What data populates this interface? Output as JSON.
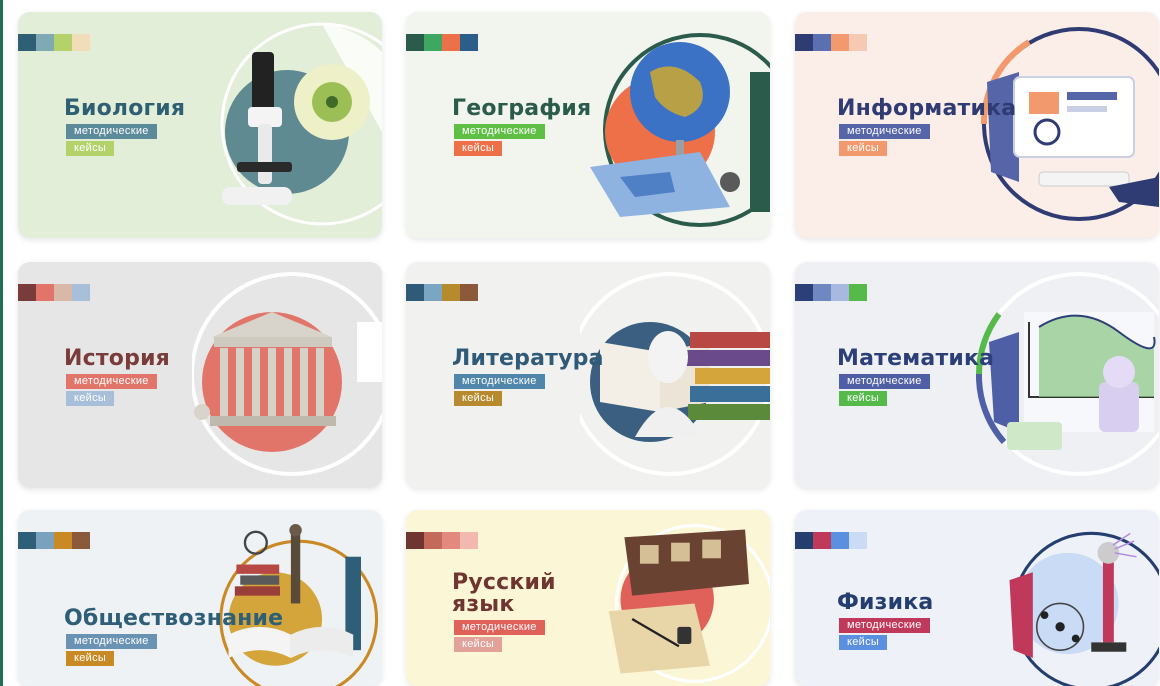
{
  "cards": [
    {
      "title": "Биология",
      "tag1": "методические",
      "tag2": "кейсы",
      "bg": "#e3eed9",
      "title_color": "#2e5f73",
      "tag1_color": "#5b8a9a",
      "tag2_color": "#b3d36a",
      "swatches": [
        "#2e5f73",
        "#7fa9b3",
        "#b3d36a",
        "#f1ddb8"
      ],
      "icon": "microscope-icon"
    },
    {
      "title": "География",
      "tag1": "методические",
      "tag2": "кейсы",
      "bg": "#f2f4ee",
      "title_color": "#2b5b4b",
      "tag1_color": "#5fbf45",
      "tag2_color": "#ee7048",
      "swatches": [
        "#2b5b4b",
        "#3ea863",
        "#ee7048",
        "#2c5e8a"
      ],
      "icon": "globe-icon"
    },
    {
      "title": "Информатика",
      "tag1": "методические",
      "tag2": "кейсы",
      "bg": "#fbeee8",
      "title_color": "#2f3b73",
      "tag1_color": "#5664a8",
      "tag2_color": "#f29a6e",
      "swatches": [
        "#2f3b73",
        "#5b6fb3",
        "#f29a6e",
        "#f6c9b2"
      ],
      "icon": "computer-icon"
    },
    {
      "title": "История",
      "tag1": "методические",
      "tag2": "кейсы",
      "bg": "#e6e6e6",
      "title_color": "#7a3c3a",
      "tag1_color": "#e2756a",
      "tag2_color": "#a7bfd9",
      "swatches": [
        "#7a3c3a",
        "#e2756a",
        "#d9b8a8",
        "#a7bfd9"
      ],
      "icon": "temple-icon"
    },
    {
      "title": "Литература",
      "tag1": "методические",
      "tag2": "кейсы",
      "bg": "#f1f2f0",
      "title_color": "#2f5a78",
      "tag1_color": "#4f86aa",
      "tag2_color": "#b88a2e",
      "swatches": [
        "#2f5a78",
        "#7aa6c4",
        "#b88a2e",
        "#8a5a3a"
      ],
      "icon": "books-bust-icon"
    },
    {
      "title": "Математика",
      "tag1": "методические",
      "tag2": "кейсы",
      "bg": "#eef0f3",
      "title_color": "#2c3f78",
      "tag1_color": "#4f5fa5",
      "tag2_color": "#56ba4a",
      "swatches": [
        "#2c3f78",
        "#6f88c2",
        "#a9b8de",
        "#56ba4a"
      ],
      "icon": "graph-icon"
    },
    {
      "title": "Обществознание",
      "tag1": "методические",
      "tag2": "кейсы",
      "bg": "#eef2f4",
      "title_color": "#2f5f78",
      "tag1_color": "#6a93b3",
      "tag2_color": "#c98a26",
      "swatches": [
        "#2f5f78",
        "#7aa2bf",
        "#c98a26",
        "#8a5a3a"
      ],
      "icon": "justice-icon"
    },
    {
      "title": "Русский\nязык",
      "tag1": "методические",
      "tag2": "кейсы",
      "bg": "#fbf6d6",
      "title_color": "#6f3530",
      "tag1_color": "#e0605a",
      "tag2_color": "#e2a29a",
      "swatches": [
        "#6f3530",
        "#c46a5a",
        "#e28a80",
        "#f3b8b0"
      ],
      "icon": "quill-icon"
    },
    {
      "title": "Физика",
      "tag1": "методические",
      "tag2": "кейсы",
      "bg": "#eef1f7",
      "title_color": "#233e6f",
      "tag1_color": "#c0395a",
      "tag2_color": "#5b8fe0",
      "swatches": [
        "#233e6f",
        "#c0395a",
        "#5b8fe0",
        "#c9dbf5"
      ],
      "icon": "atom-icon"
    }
  ]
}
